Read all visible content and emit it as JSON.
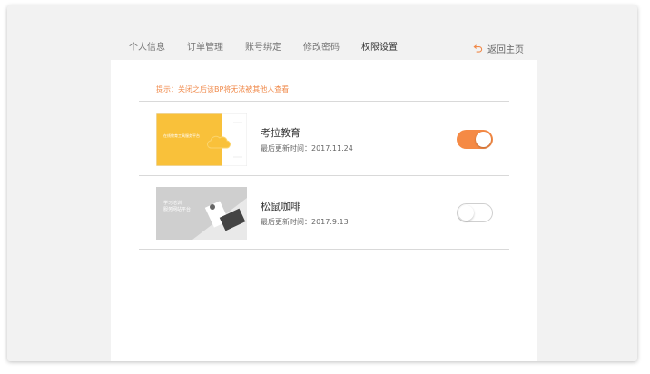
{
  "tabs": [
    {
      "label": "个人信息",
      "active": false
    },
    {
      "label": "订单管理",
      "active": false
    },
    {
      "label": "账号绑定",
      "active": false
    },
    {
      "label": "修改密码",
      "active": false
    },
    {
      "label": "权限设置",
      "active": true
    }
  ],
  "back_link": {
    "label": "返回主页",
    "icon": "return-arrow-icon"
  },
  "notice": "提示：关闭之后该BP将无法被其他人查看",
  "items": [
    {
      "title": "考拉教育",
      "updated": "最后更新时间：2017.11.24",
      "enabled": true,
      "thumbnail": {
        "theme": "yellow",
        "caption": "在线教育工具服务平台"
      }
    },
    {
      "title": "松鼠咖啡",
      "updated": "最后更新时间：2017.9.13",
      "enabled": false,
      "thumbnail": {
        "theme": "gray",
        "caption_line1": "学习培训",
        "caption_line2": "服务网站平台"
      }
    }
  ],
  "colors": {
    "accent": "#f58a45",
    "notice": "#f08a4b"
  }
}
